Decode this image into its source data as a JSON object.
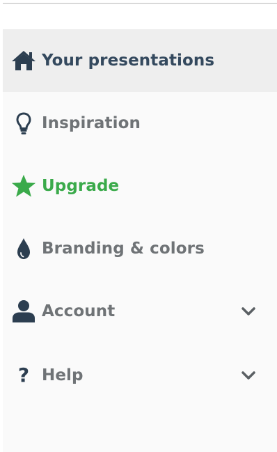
{
  "sidebar": {
    "items": [
      {
        "label": "Your presentations",
        "icon": "home-icon",
        "active": true
      },
      {
        "label": "Inspiration",
        "icon": "lightbulb-icon"
      },
      {
        "label": "Upgrade",
        "icon": "star-icon",
        "color": "#3aaa4a"
      },
      {
        "label": "Branding & colors",
        "icon": "droplet-icon"
      },
      {
        "label": "Account",
        "icon": "user-icon",
        "expandable": true
      },
      {
        "label": "Help",
        "icon": "question-icon",
        "expandable": true,
        "icon_glyph": "?"
      }
    ]
  },
  "colors": {
    "active_text": "#34495e",
    "default_text": "#6f7376",
    "accent_green": "#3aaa4a",
    "icon_dark": "#2c3e50",
    "active_background": "#eeeeee"
  }
}
